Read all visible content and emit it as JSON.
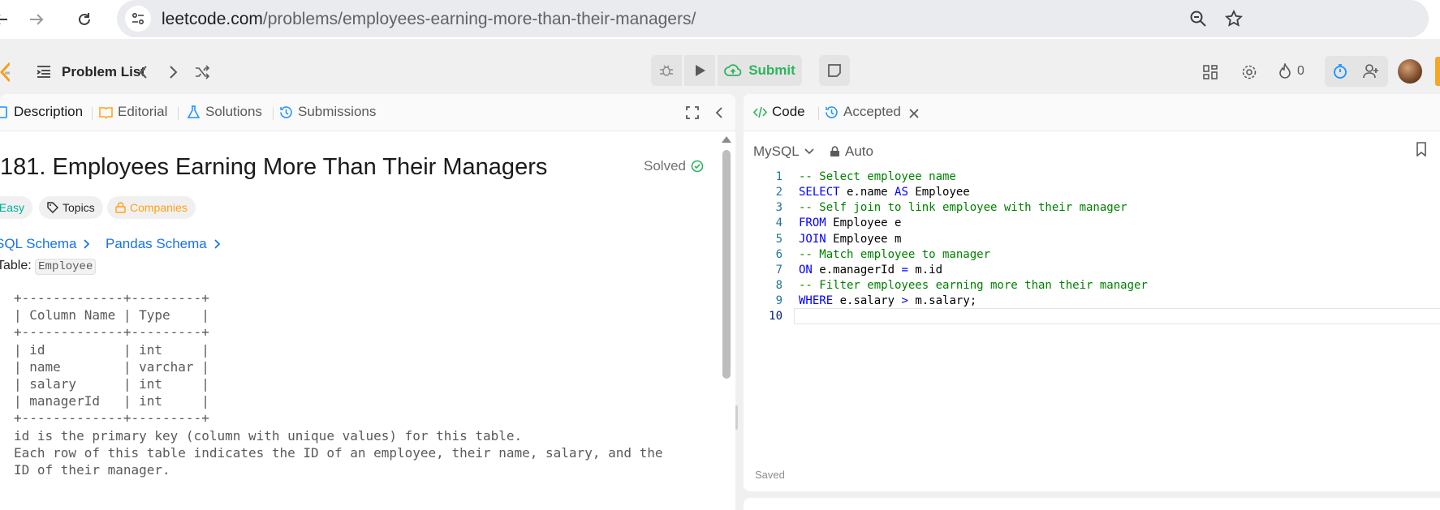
{
  "browser": {
    "url_host": "leetcode.com",
    "url_path": "/problems/employees-earning-more-than-their-managers/",
    "icons": [
      "back-icon",
      "forward-icon",
      "reload-icon",
      "site-info-icon",
      "zoom-icon",
      "star-icon"
    ]
  },
  "topbar": {
    "problem_list_label": "Problem List",
    "submit_label": "Submit",
    "streak_count": "0"
  },
  "left_panel": {
    "tabs": [
      {
        "label": "Description"
      },
      {
        "label": "Editorial"
      },
      {
        "label": "Solutions"
      },
      {
        "label": "Submissions"
      }
    ],
    "title": "181. Employees Earning More Than Their Managers",
    "solved_label": "Solved",
    "difficulty": "Easy",
    "topics_label": "Topics",
    "companies_label": "Companies",
    "sql_schema_label": "SQL Schema",
    "pandas_schema_label": "Pandas Schema",
    "table_prefix": "Table: ",
    "table_name": "Employee",
    "schema_text": "+-------------+---------+\n| Column Name | Type    |\n+-------------+---------+\n| id          | int     |\n| name        | varchar |\n| salary      | int     |\n| managerId   | int     |\n+-------------+---------+\nid is the primary key (column with unique values) for this table.\nEach row of this table indicates the ID of an employee, their name, salary, and the\nID of their manager."
  },
  "right_panel": {
    "tabs": [
      {
        "label": "Code"
      },
      {
        "label": "Accepted"
      }
    ],
    "language": "MySQL",
    "auto_label": "Auto",
    "saved_label": "Saved",
    "code_lines": [
      {
        "num": "1",
        "parts": [
          {
            "t": "-- Select employee name",
            "c": "cmt"
          }
        ]
      },
      {
        "num": "2",
        "parts": [
          {
            "t": "SELECT",
            "c": "kw"
          },
          {
            "t": " e.name ",
            "c": ""
          },
          {
            "t": "AS",
            "c": "kw"
          },
          {
            "t": " Employee",
            "c": ""
          }
        ]
      },
      {
        "num": "3",
        "parts": [
          {
            "t": "-- Self join to link employee with their manager",
            "c": "cmt"
          }
        ]
      },
      {
        "num": "4",
        "parts": [
          {
            "t": "FROM",
            "c": "kw"
          },
          {
            "t": " Employee e",
            "c": ""
          }
        ]
      },
      {
        "num": "5",
        "parts": [
          {
            "t": "JOIN",
            "c": "kw"
          },
          {
            "t": " Employee m",
            "c": ""
          }
        ]
      },
      {
        "num": "6",
        "parts": [
          {
            "t": "-- Match employee to manager",
            "c": "cmt"
          }
        ]
      },
      {
        "num": "7",
        "parts": [
          {
            "t": "ON",
            "c": "kw"
          },
          {
            "t": " e.managerId ",
            "c": ""
          },
          {
            "t": "=",
            "c": "kw"
          },
          {
            "t": " m.id",
            "c": ""
          }
        ]
      },
      {
        "num": "8",
        "parts": [
          {
            "t": "-- Filter employees earning more than their manager",
            "c": "cmt"
          }
        ]
      },
      {
        "num": "9",
        "parts": [
          {
            "t": "WHERE",
            "c": "kw"
          },
          {
            "t": " e.salary ",
            "c": ""
          },
          {
            "t": ">",
            "c": "kw"
          },
          {
            "t": " m.salary;",
            "c": ""
          }
        ]
      },
      {
        "num": "10",
        "parts": []
      }
    ]
  },
  "colors": {
    "accent_green": "#2db55d",
    "easy_teal": "#00af9b",
    "link_blue": "#1a73e8",
    "companies_orange": "#ffa116",
    "timer_blue": "#1a90ff"
  }
}
